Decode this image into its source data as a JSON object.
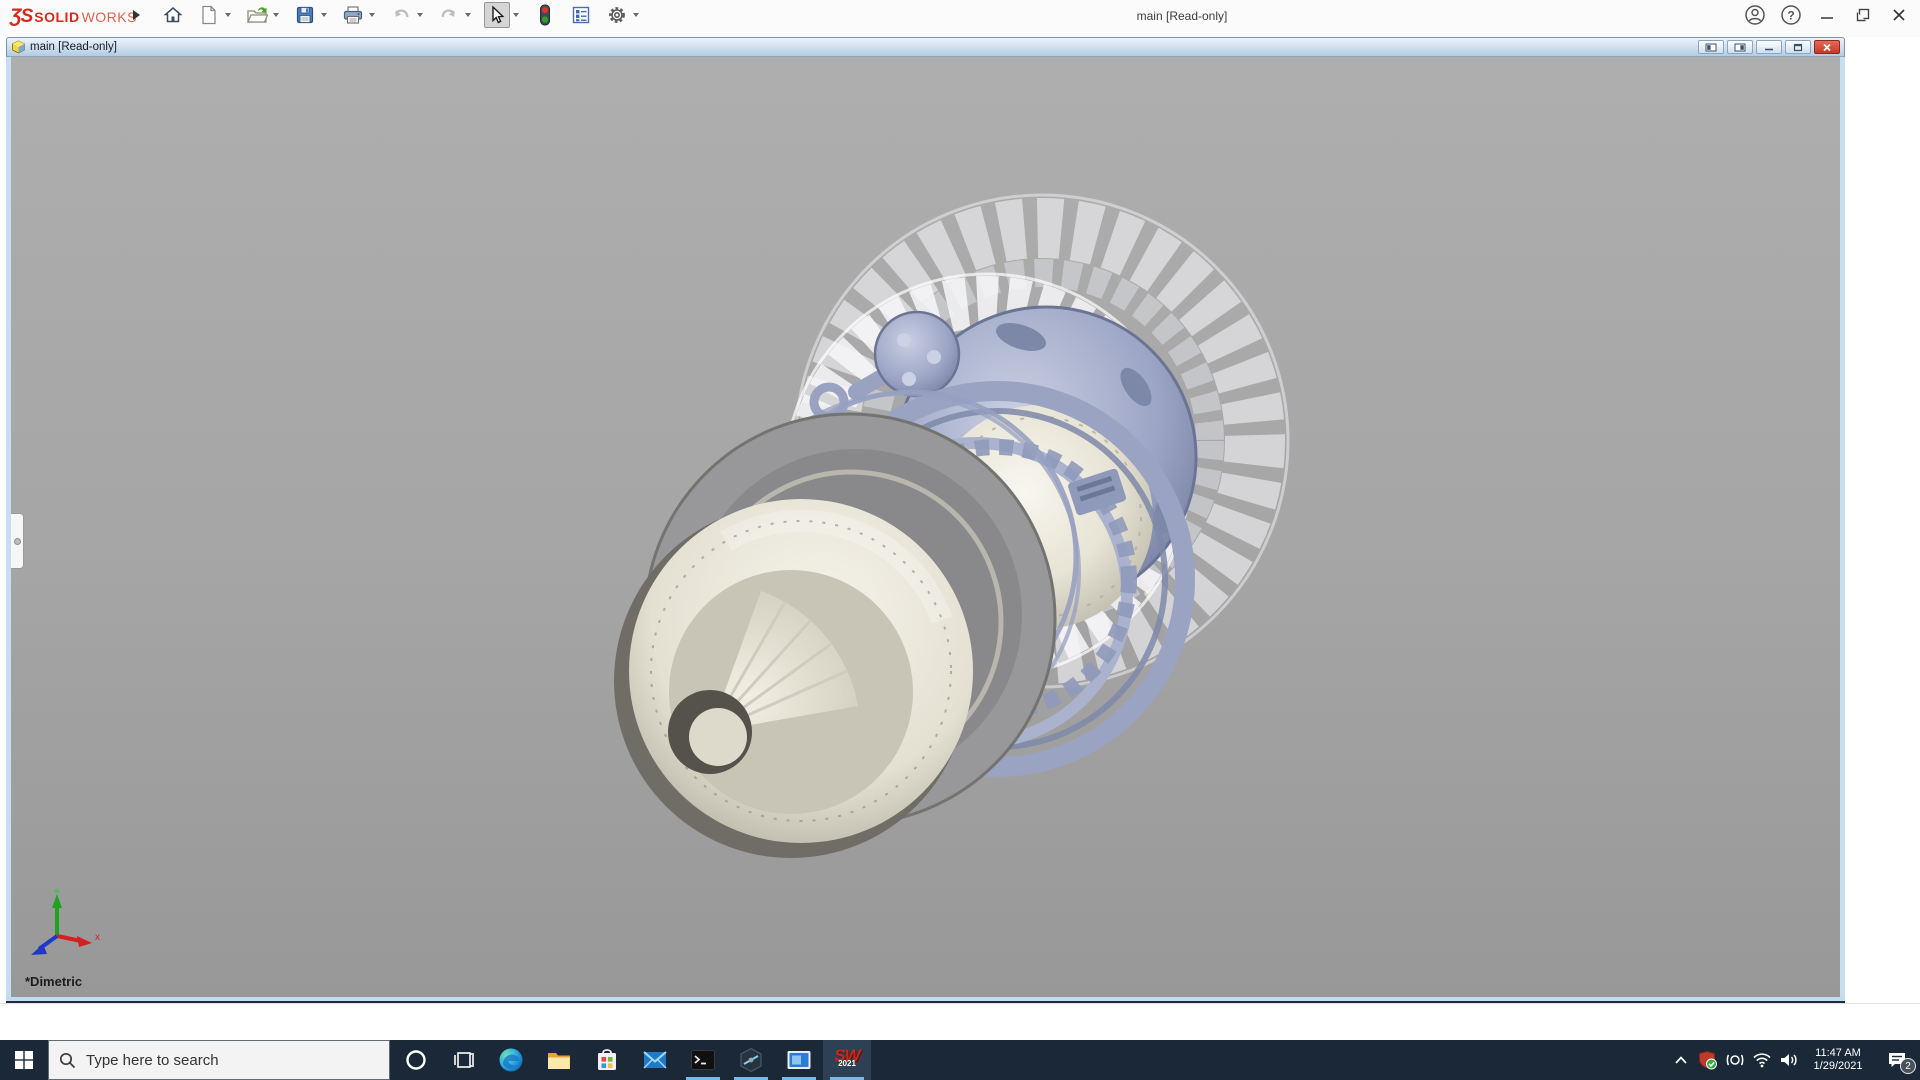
{
  "app": {
    "brand_glyph": "ƷS",
    "brand_bold": "SOLID",
    "brand_light": "WORKS",
    "window_title": "main [Read-only]",
    "help_glyph": "?"
  },
  "toolbar": {
    "icons": [
      "flyout-arrow",
      "home",
      "new-document",
      "open",
      "save",
      "print",
      "undo",
      "redo",
      "select-cursor",
      "rebuild-traffic-light",
      "property-manager",
      "options-gear"
    ],
    "right_icons": [
      "account",
      "help",
      "minimize",
      "restore",
      "close"
    ]
  },
  "document_window": {
    "title": "main [Read-only]",
    "buttons": [
      "pane-left",
      "pane-right",
      "minimize",
      "restore",
      "close"
    ]
  },
  "viewport": {
    "view_orientation_label": "*Dimetric",
    "triad_x_label": "x"
  },
  "taskbar": {
    "search_placeholder": "Type here to search",
    "apps": [
      "edge",
      "file-explorer",
      "store",
      "mail",
      "terminal",
      "edrawings",
      "display-app",
      "solidworks-2021"
    ],
    "running_apps": [
      "terminal",
      "edrawings",
      "display-app",
      "solidworks-2021"
    ],
    "sw_icon_text": "SW",
    "sw_icon_year": "2021",
    "tray": {
      "icons": [
        "chevron-up",
        "solidworks-resource-monitor",
        "meet-now",
        "wifi",
        "volume",
        "action-center"
      ],
      "time": "11:47 AM",
      "date": "1/29/2021",
      "notification_count": "2"
    }
  },
  "colors": {
    "taskbar_bg": "#1b2838",
    "running_indicator": "#7ab8e8",
    "close_red": "#c33a28",
    "doc_titlebar_blue": "#b4cbe3",
    "viewport_gray": "#a5a5a5",
    "brand_red": "#d52b1e",
    "model_periwinkle": "#9ba4c4",
    "model_cream": "#ece8dc"
  }
}
